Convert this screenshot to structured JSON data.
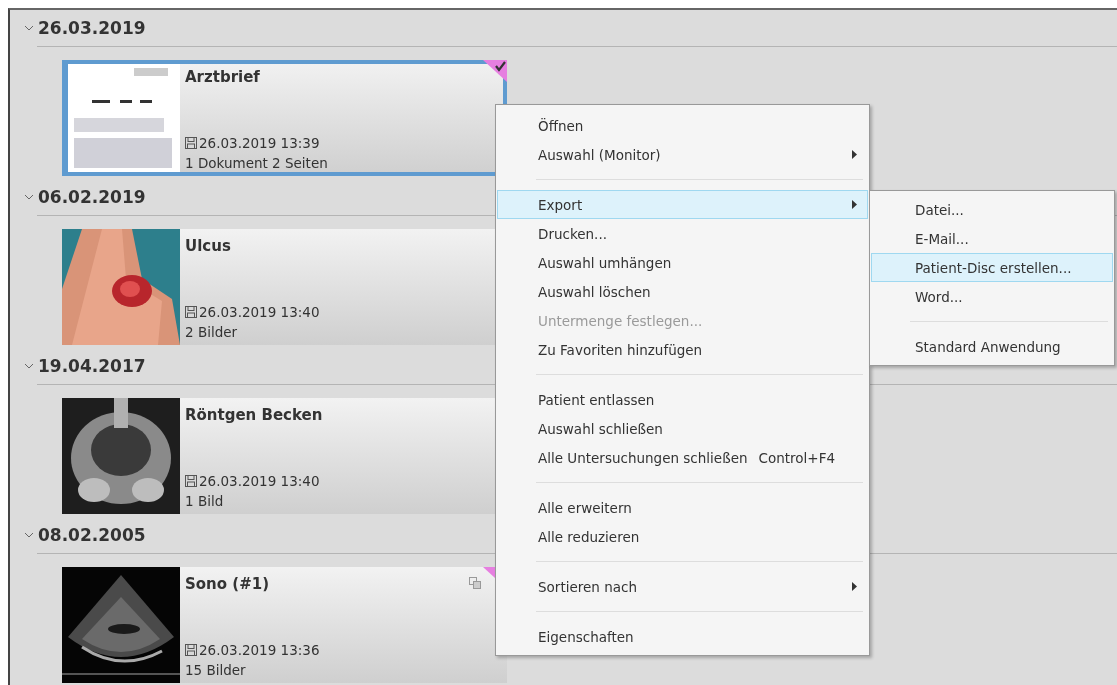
{
  "groups": [
    {
      "date": "26.03.2019",
      "expanded": true,
      "cards": [
        {
          "title": "Arztbrief",
          "saved": "26.03.2019 13:39",
          "count": "1 Dokument 2 Seiten",
          "selected": true,
          "marked": true,
          "linked": false
        }
      ]
    },
    {
      "date": "06.02.2019",
      "expanded": true,
      "cards": [
        {
          "title": "Ulcus",
          "saved": "26.03.2019 13:40",
          "count": "2 Bilder",
          "selected": false,
          "marked": false,
          "linked": false
        }
      ]
    },
    {
      "date": "19.04.2017",
      "expanded": true,
      "cards": [
        {
          "title": "Röntgen Becken",
          "saved": "26.03.2019 13:40",
          "count": "1 Bild",
          "selected": false,
          "marked": false,
          "linked": false
        }
      ]
    },
    {
      "date": "08.02.2005",
      "expanded": true,
      "cards": [
        {
          "title": "Sono (#1)",
          "saved": "26.03.2019 13:36",
          "count": "15 Bilder",
          "selected": false,
          "marked": true,
          "linked": true
        }
      ]
    }
  ],
  "context_menu": {
    "items": [
      {
        "kind": "item",
        "label": "Öffnen",
        "disabled": false,
        "selected": false,
        "submenu": false
      },
      {
        "kind": "item",
        "label": "Auswahl (Monitor)",
        "disabled": false,
        "selected": false,
        "submenu": true
      },
      {
        "kind": "separator"
      },
      {
        "kind": "item",
        "label": "Export",
        "disabled": false,
        "selected": true,
        "submenu": true
      },
      {
        "kind": "item",
        "label": "Drucken...",
        "disabled": false,
        "selected": false,
        "submenu": false
      },
      {
        "kind": "item",
        "label": "Auswahl umhängen",
        "disabled": false,
        "selected": false,
        "submenu": false
      },
      {
        "kind": "item",
        "label": "Auswahl löschen",
        "disabled": false,
        "selected": false,
        "submenu": false
      },
      {
        "kind": "item",
        "label": "Untermenge festlegen...",
        "disabled": true,
        "selected": false,
        "submenu": false
      },
      {
        "kind": "item",
        "label": "Zu Favoriten hinzufügen",
        "disabled": false,
        "selected": false,
        "submenu": false
      },
      {
        "kind": "separator"
      },
      {
        "kind": "item",
        "label": "Patient entlassen",
        "disabled": false,
        "selected": false,
        "submenu": false
      },
      {
        "kind": "item",
        "label": "Auswahl schließen",
        "disabled": false,
        "selected": false,
        "submenu": false
      },
      {
        "kind": "item",
        "label": "Alle Untersuchungen schließen",
        "shortcut": "Control+F4",
        "disabled": false,
        "selected": false,
        "submenu": false
      },
      {
        "kind": "separator"
      },
      {
        "kind": "item",
        "label": "Alle erweitern",
        "disabled": false,
        "selected": false,
        "submenu": false
      },
      {
        "kind": "item",
        "label": "Alle reduzieren",
        "disabled": false,
        "selected": false,
        "submenu": false
      },
      {
        "kind": "separator"
      },
      {
        "kind": "item",
        "label": "Sortieren nach",
        "disabled": false,
        "selected": false,
        "submenu": true
      },
      {
        "kind": "separator"
      },
      {
        "kind": "item",
        "label": "Eigenschaften",
        "disabled": false,
        "selected": false,
        "submenu": false
      }
    ]
  },
  "submenu": {
    "items": [
      {
        "kind": "item",
        "label": "Datei...",
        "disabled": false,
        "selected": false,
        "submenu": false
      },
      {
        "kind": "item",
        "label": "E-Mail...",
        "disabled": false,
        "selected": false,
        "submenu": false
      },
      {
        "kind": "item",
        "label": "Patient-Disc erstellen...",
        "disabled": false,
        "selected": true,
        "submenu": false
      },
      {
        "kind": "item",
        "label": "Word...",
        "disabled": false,
        "selected": false,
        "submenu": false
      },
      {
        "kind": "separator"
      },
      {
        "kind": "item",
        "label": "Standard Anwendung",
        "disabled": false,
        "selected": false,
        "submenu": false
      }
    ]
  }
}
